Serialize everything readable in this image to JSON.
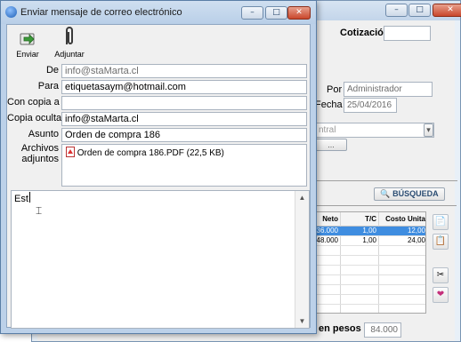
{
  "background_window": {
    "cotizacion_label": "Cotización",
    "por_label": "Por",
    "por_value": "Administrador",
    "fecha_label": "Fecha",
    "fecha_value": "25/04/2016",
    "combo_value": "ntral",
    "small_button": "...",
    "busqueda_label": "BÚSQUEDA",
    "grid": {
      "columns": [
        "Neto",
        "T/C",
        "Costo Unita"
      ],
      "rows": [
        [
          "36.000",
          "1,00",
          "12,00"
        ],
        [
          "48.000",
          "1,00",
          "24,00"
        ]
      ]
    },
    "total_label": "en pesos",
    "total_value": "84.000"
  },
  "dialog": {
    "title": "Enviar mensaje de correo electrónico",
    "toolbar": {
      "send_label": "Enviar",
      "attach_label": "Adjuntar"
    },
    "fields": {
      "de_label": "De",
      "de_value": "info@staMarta.cl",
      "para_label": "Para",
      "para_value": "etiquetasaym@hotmail.com",
      "cc_label": "Con copia a",
      "cc_value": "",
      "bcc_label": "Copia oculta",
      "bcc_value": "info@staMarta.cl",
      "asunto_label": "Asunto",
      "asunto_value": "Orden de compra 186",
      "adjuntos_label_1": "Archivos",
      "adjuntos_label_2": "adjuntos",
      "attachment": "Orden de compra 186.PDF (22,5 KB)"
    },
    "body_text": "Est"
  }
}
